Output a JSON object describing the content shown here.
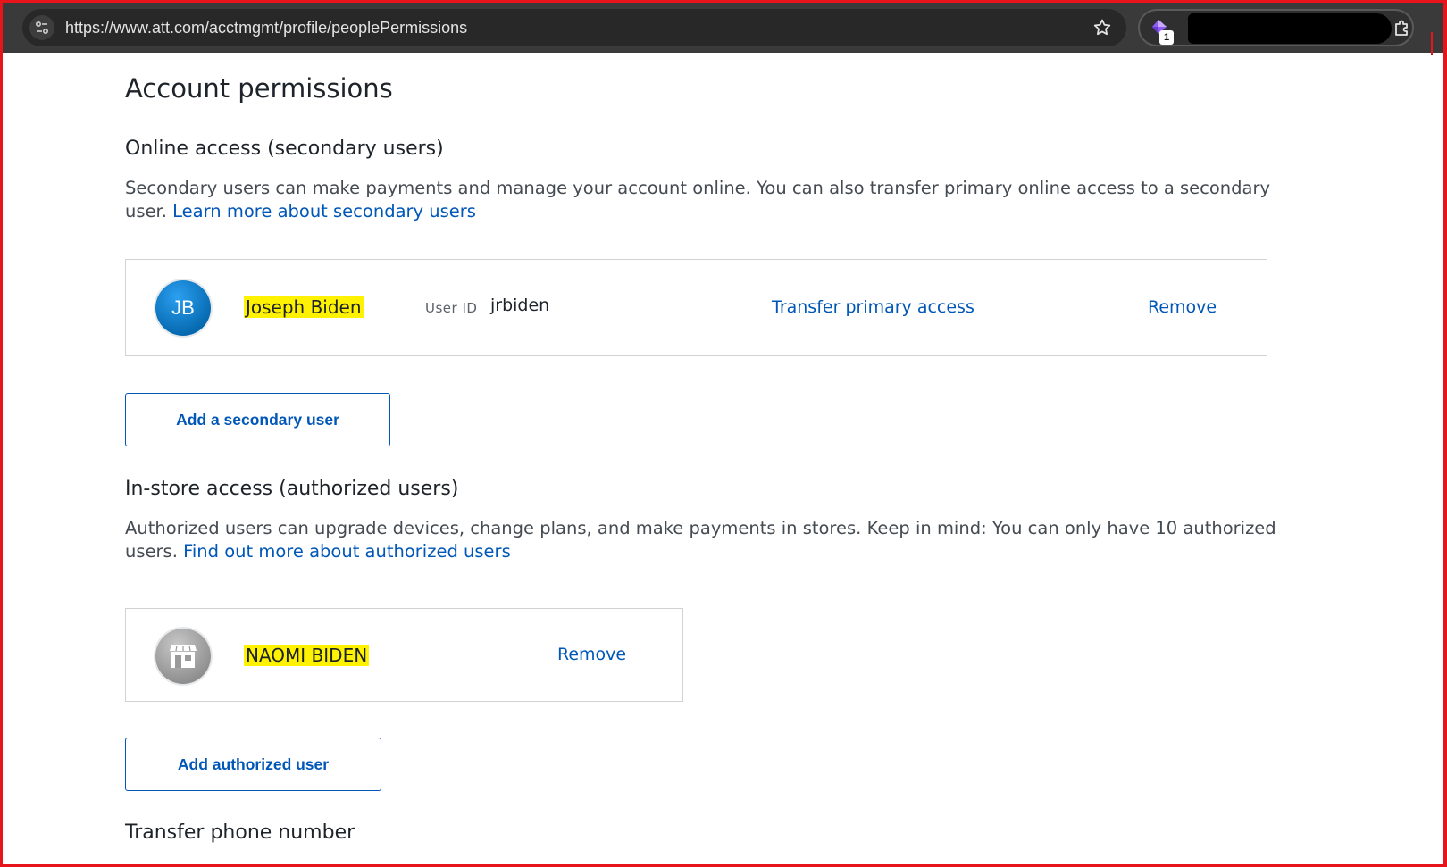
{
  "browser": {
    "url": "https://www.att.com/acctmgmt/profile/peoplePermissions",
    "extension_badge": "1"
  },
  "page": {
    "title": "Account permissions",
    "online_access": {
      "heading": "Online access (secondary users)",
      "description": "Secondary users can make payments and manage your account online. You can also transfer primary online access to a secondary user.",
      "learn_more_link": "Learn more about secondary users",
      "users": [
        {
          "initials": "JB",
          "name": "Joseph Biden",
          "user_id_label": "User ID",
          "user_id": "jrbiden",
          "transfer_link": "Transfer primary access",
          "remove_link": "Remove"
        }
      ],
      "add_button": "Add a secondary user"
    },
    "in_store_access": {
      "heading": "In-store access (authorized users)",
      "description": "Authorized users can upgrade devices, change plans, and make payments in stores. Keep in mind: You can only have 10 authorized users.",
      "find_out_link": "Find out more about authorized users",
      "users": [
        {
          "icon": "store-icon",
          "name": "NAOMI BIDEN",
          "remove_link": "Remove"
        }
      ],
      "add_button": "Add authorized user"
    },
    "transfer_phone": {
      "heading": "Transfer phone number"
    }
  },
  "colors": {
    "link": "#0057b8",
    "highlight": "#fff200",
    "frame": "#e8141c",
    "avatar_blue": "#0568ae"
  }
}
